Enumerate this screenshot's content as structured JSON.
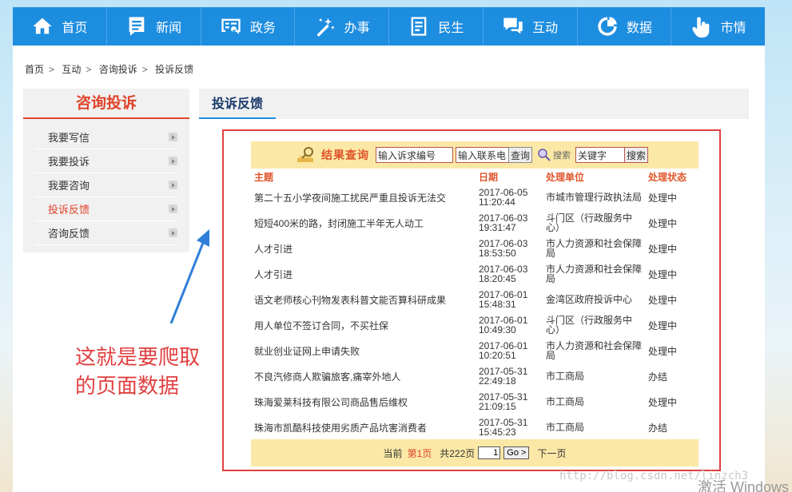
{
  "nav": {
    "items": [
      {
        "label": "首页",
        "icon": "home-icon"
      },
      {
        "label": "新闻",
        "icon": "news-icon"
      },
      {
        "label": "政务",
        "icon": "government-icon"
      },
      {
        "label": "办事",
        "icon": "service-icon"
      },
      {
        "label": "民生",
        "icon": "livelihood-icon"
      },
      {
        "label": "互动",
        "icon": "chat-icon"
      },
      {
        "label": "数据",
        "icon": "pie-chart-icon"
      },
      {
        "label": "市情",
        "icon": "hand-pointer-icon"
      }
    ]
  },
  "breadcrumb": {
    "items": [
      "首页",
      "互动",
      "咨询投诉",
      "投诉反馈"
    ],
    "separator": ">"
  },
  "sidebar": {
    "title": "咨询投诉",
    "items": [
      {
        "label": "我要写信"
      },
      {
        "label": "我要投诉"
      },
      {
        "label": "我要咨询"
      },
      {
        "label": "投诉反馈",
        "active": true
      },
      {
        "label": "咨询反馈"
      }
    ]
  },
  "content": {
    "title": "投诉反馈"
  },
  "query": {
    "label": "结果查询",
    "case_number_value": "输入诉求编号",
    "phone_value": "输入联系电",
    "query_button": "查询",
    "search_label": "搜索",
    "keyword_value": "关键字",
    "search_button": "搜索"
  },
  "table": {
    "headers": [
      "主题",
      "日期",
      "处理单位",
      "处理状态"
    ],
    "rows": [
      {
        "subject": "第二十五小学夜间施工扰民严重且投诉无法交",
        "date": "2017-06-05\n11:20:44",
        "unit": "市城市管理行政执法局",
        "status": "处理中"
      },
      {
        "subject": "短短400米的路，封闭施工半年无人动工",
        "date": "2017-06-03\n19:31:47",
        "unit": "斗门区（行政服务中心）",
        "status": "处理中"
      },
      {
        "subject": "人才引进",
        "date": "2017-06-03\n18:53:50",
        "unit": "市人力资源和社会保障局",
        "status": "处理中"
      },
      {
        "subject": "人才引进",
        "date": "2017-06-03\n18:20:45",
        "unit": "市人力资源和社会保障局",
        "status": "处理中"
      },
      {
        "subject": "语文老师核心刊物发表科普文能否算科研成果",
        "date": "2017-06-01\n15:48:31",
        "unit": "金湾区政府投诉中心",
        "status": "处理中"
      },
      {
        "subject": "用人单位不签订合同，不买社保",
        "date": "2017-06-01\n10:49:30",
        "unit": "斗门区（行政服务中心）",
        "status": "处理中"
      },
      {
        "subject": "就业创业证网上申请失败",
        "date": "2017-06-01\n10:20:51",
        "unit": "市人力资源和社会保障局",
        "status": "处理中"
      },
      {
        "subject": "不良汽修商人欺骗旅客,痛宰外地人",
        "date": "2017-05-31\n22:49:18",
        "unit": "市工商局",
        "status": "办结"
      },
      {
        "subject": "珠海爱莱科技有限公司商品售后维权",
        "date": "2017-05-31\n21:09:15",
        "unit": "市工商局",
        "status": "处理中"
      },
      {
        "subject": "珠海市凯酷科技使用劣质产品坑害消费者",
        "date": "2017-05-31\n15:45:23",
        "unit": "市工商局",
        "status": "办结"
      }
    ]
  },
  "pager": {
    "current_prefix": "当前",
    "current_page": "第1页",
    "total": "共222页",
    "page_value": "1",
    "go_label": "Go >",
    "next_label": "下一页"
  },
  "annotation": {
    "line1": "这就是要爬取",
    "line2": "的页面数据"
  },
  "watermark": "http://blog.csdn.net/linzch3",
  "os_overlay": "激活 Windows",
  "colors": {
    "nav_blue": "#1d8de0",
    "accent_red": "#e0432a",
    "highlight_box": "#e04040",
    "query_bar": "#fbe8a6"
  }
}
